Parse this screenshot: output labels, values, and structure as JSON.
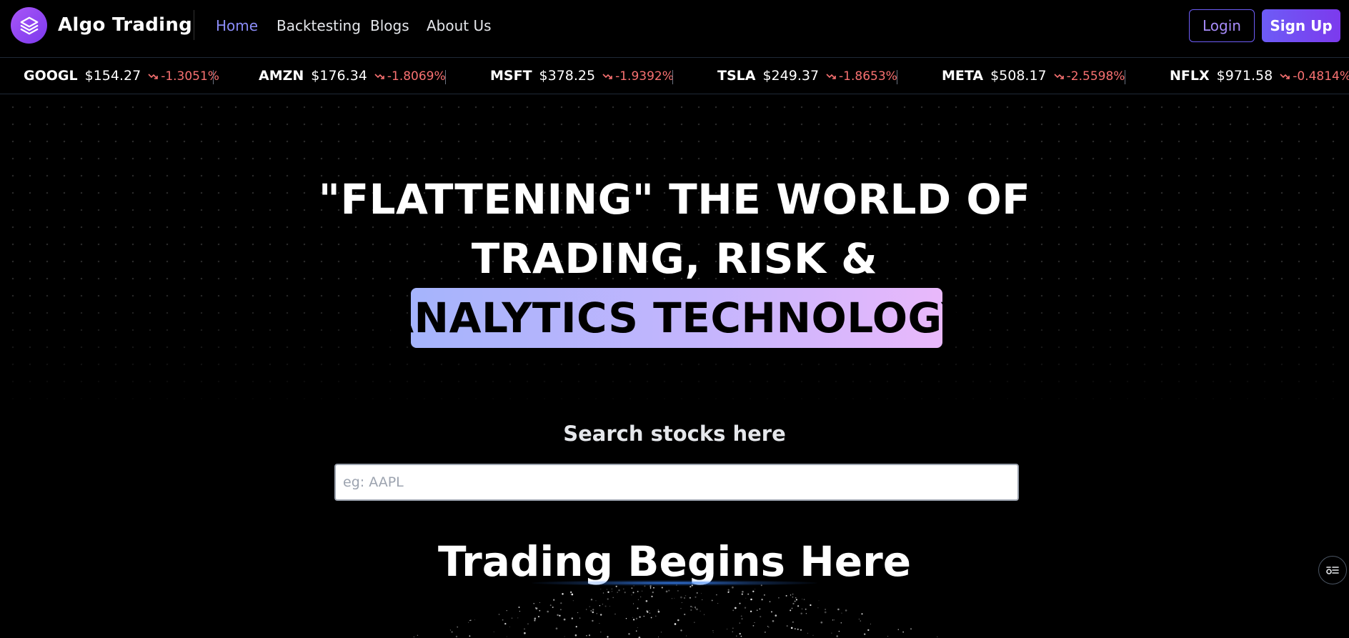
{
  "header": {
    "brand": "Algo Trading",
    "nav": [
      {
        "label": "Home",
        "active": true
      },
      {
        "label": "Backtesting",
        "active": false
      },
      {
        "label": "Blogs",
        "active": false
      },
      {
        "label": "About Us",
        "active": false
      }
    ],
    "login_label": "Login",
    "signup_label": "Sign Up"
  },
  "ticker": [
    {
      "symbol": "GOOGL",
      "price": "$154.27",
      "change": "-1.3051%"
    },
    {
      "symbol": "AMZN",
      "price": "$176.34",
      "change": "-1.8069%"
    },
    {
      "symbol": "MSFT",
      "price": "$378.25",
      "change": "-1.9392%"
    },
    {
      "symbol": "TSLA",
      "price": "$249.37",
      "change": "-1.8653%"
    },
    {
      "symbol": "META",
      "price": "$508.17",
      "change": "-2.5598%"
    },
    {
      "symbol": "NFLX",
      "price": "$971.58",
      "change": "-0.4814%"
    }
  ],
  "hero": {
    "line1": "\"FLATTENING\" THE WORLD OF",
    "line2": "TRADING, RISK &",
    "line3": "ANALYTICS TECHNOLOGY"
  },
  "search": {
    "label": "Search stocks here",
    "placeholder": "eg: AAPL",
    "value": ""
  },
  "trading": {
    "title": "Trading Begins Here"
  },
  "colors": {
    "accent": "#7c3aed",
    "nav_active": "#8b8cf8",
    "negative": "#f87171",
    "highlight_start": "#a5b4fc",
    "highlight_end": "#e9b8fb"
  }
}
